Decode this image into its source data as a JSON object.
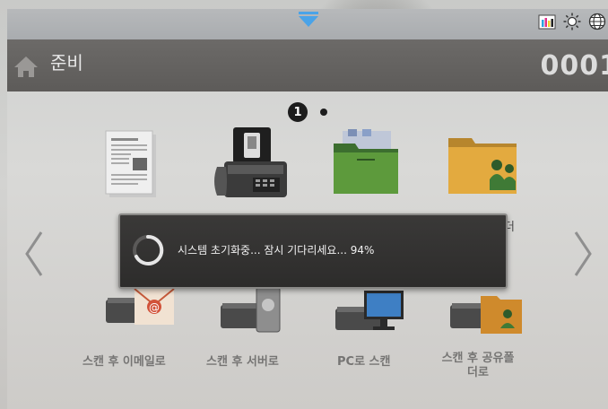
{
  "header": {
    "title": "준비",
    "counter": "0001"
  },
  "status_bar": {
    "icons": [
      "toner-level-icon",
      "brightness-icon",
      "globe-icon"
    ],
    "pulldown": "pulldown-arrow-icon"
  },
  "page_indicator": {
    "current": "1",
    "total_pages": 2
  },
  "apps_row1": [
    {
      "name": "copy-icon"
    },
    {
      "name": "fax-icon"
    },
    {
      "name": "folder-green-icon"
    },
    {
      "name": "shared-folder-icon",
      "label_fragment": "더"
    }
  ],
  "apps_row2": [
    {
      "name": "scan-to-email-icon",
      "label": "스캔 후 이메일로"
    },
    {
      "name": "scan-to-server-icon",
      "label": "스캔 후 서버로"
    },
    {
      "name": "scan-to-pc-icon",
      "label": "PC로 스캔"
    },
    {
      "name": "scan-to-shared-folder-icon",
      "label": "스캔 후 공유폴더로"
    }
  ],
  "dialog": {
    "message": "시스템 초기화중... 잠시 기다리세요... 94%",
    "progress_percent": 94
  },
  "colors": {
    "header_bg": "#5d5b59",
    "dialog_bg": "#2d2c2b",
    "pulldown_blue": "#4aa3e8"
  }
}
